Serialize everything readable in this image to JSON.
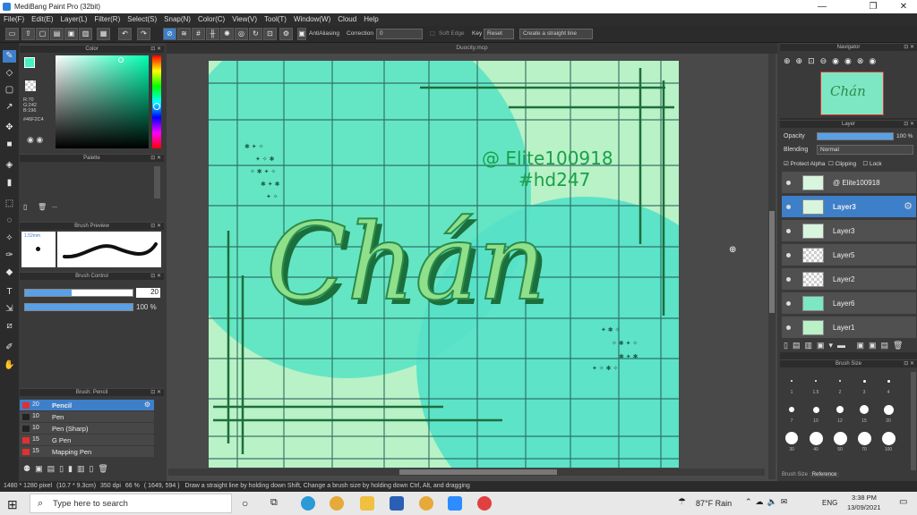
{
  "window": {
    "title": "MediBang Paint Pro (32bit)",
    "minimize": "—",
    "maximize": "❐",
    "close": "✕"
  },
  "menu": [
    "File(F)",
    "Edit(E)",
    "Layer(L)",
    "Filter(R)",
    "Select(S)",
    "Snap(N)",
    "Color(C)",
    "View(V)",
    "Tool(T)",
    "Window(W)",
    "Cloud",
    "Help"
  ],
  "toolbar": {
    "antialiasing": "AntiAliasing",
    "correction_label": "Correction",
    "correction_value": "0",
    "soft_edge": "Soft Edge",
    "key_label": "Key",
    "reset": "Reset",
    "straight_line": "Create a straight line"
  },
  "color_panel": {
    "title": "Color",
    "r": "R:70",
    "g": "G:242",
    "b": "B:196",
    "hex": "#46F2C4",
    "main_color": "#46f2c4"
  },
  "palette_panel": {
    "title": "Palette",
    "placeholder": "---"
  },
  "brush_preview": {
    "title": "Brush Preview",
    "size": "1.52mm"
  },
  "brush_control": {
    "title": "Brush Control",
    "size_value": "20",
    "opacity_value": "100 %",
    "size_fraction": 0.43,
    "opacity_fraction": 1.0
  },
  "brush_list": {
    "title": "Brush: Pencil",
    "items": [
      {
        "size": "20",
        "name": "Pencil",
        "color": "#e03030"
      },
      {
        "size": "10",
        "name": "Pen",
        "color": "#222222"
      },
      {
        "size": "10",
        "name": "Pen (Sharp)",
        "color": "#222222"
      },
      {
        "size": "15",
        "name": "G Pen",
        "color": "#e03030"
      },
      {
        "size": "15",
        "name": "Mapping Pen",
        "color": "#e03030"
      }
    ]
  },
  "document": {
    "tab": "Duocity.mcp"
  },
  "artwork": {
    "word": "Chán",
    "tag1": "@ Elite100918",
    "tag2": "#hd247"
  },
  "navigator": {
    "title": "Navigator"
  },
  "layer_panel": {
    "title": "Layer",
    "opacity_label": "Opacity",
    "opacity_value": "100 %",
    "blending_label": "Blending",
    "blending_value": "Normal",
    "protect_alpha": "Protect Alpha",
    "clipping": "Clipping",
    "lock": "Lock",
    "layers": [
      "@ Elite100918",
      "Layer3",
      "Layer3",
      "Layer5",
      "Layer2",
      "Layer6",
      "Layer1"
    ]
  },
  "brush_size_panel": {
    "title": "Brush Size",
    "labels": [
      "1",
      "1.5",
      "2",
      "3",
      "4",
      "7",
      "10",
      "12",
      "15",
      "20",
      "30",
      "40",
      "50",
      "70",
      "100"
    ],
    "tabs": [
      "Brush Size",
      "Reference"
    ]
  },
  "status": {
    "dims": "1480 * 1280 pixel",
    "size": "(10.7 * 9.3cm)",
    "dpi": "350 dpi",
    "zoom": "66 %",
    "coords": "( 1649, 594 )",
    "hint": "Draw a straight line by holding down Shift, Change a brush size by holding down Ctrl, Alt, and dragging"
  },
  "taskbar": {
    "search": "Type here to search",
    "weather": "87°F  Rain",
    "lang": "ENG",
    "time": "3:38 PM",
    "date": "13/09/2021"
  }
}
